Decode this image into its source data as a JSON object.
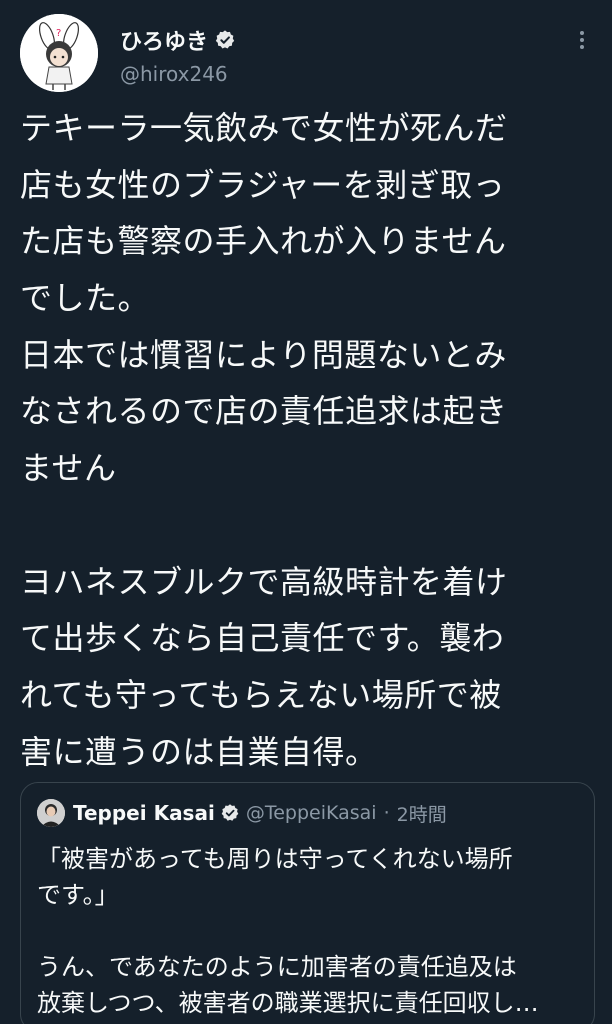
{
  "author": {
    "display_name": "ひろゆき",
    "handle": "@hirox246",
    "verified_icon": "verified-badge-icon",
    "menu_icon": "more-options-icon"
  },
  "tweet": {
    "lines": [
      "テキーラ一気飲みで女性が死んだ",
      "店も女性のブラジャーを剥ぎ取っ",
      "た店も警察の手入れが入りません",
      "でした。",
      "日本では慣習により問題ないとみ",
      "なされるので店の責任追求は起き",
      "ません",
      "",
      "ヨハネスブルクで高級時計を着け",
      "て出歩くなら自己責任です。襲わ",
      "れても守ってもらえない場所で被",
      "害に遭うのは自業自得。"
    ]
  },
  "quote": {
    "display_name": "Teppei Kasai",
    "handle": "@TeppeiKasai",
    "separator": "·",
    "time": "2時間",
    "lines": [
      "「被害があっても周りは守ってくれない場所",
      "です。」",
      "",
      "うん、であなたのように加害者の責任追及は",
      "放棄しつつ、被害者の職業選択に責任回収し…"
    ]
  },
  "colors": {
    "background": "#15202b",
    "text": "#f7f9f9",
    "secondary_text": "#8b98a5",
    "border": "#38444d"
  }
}
